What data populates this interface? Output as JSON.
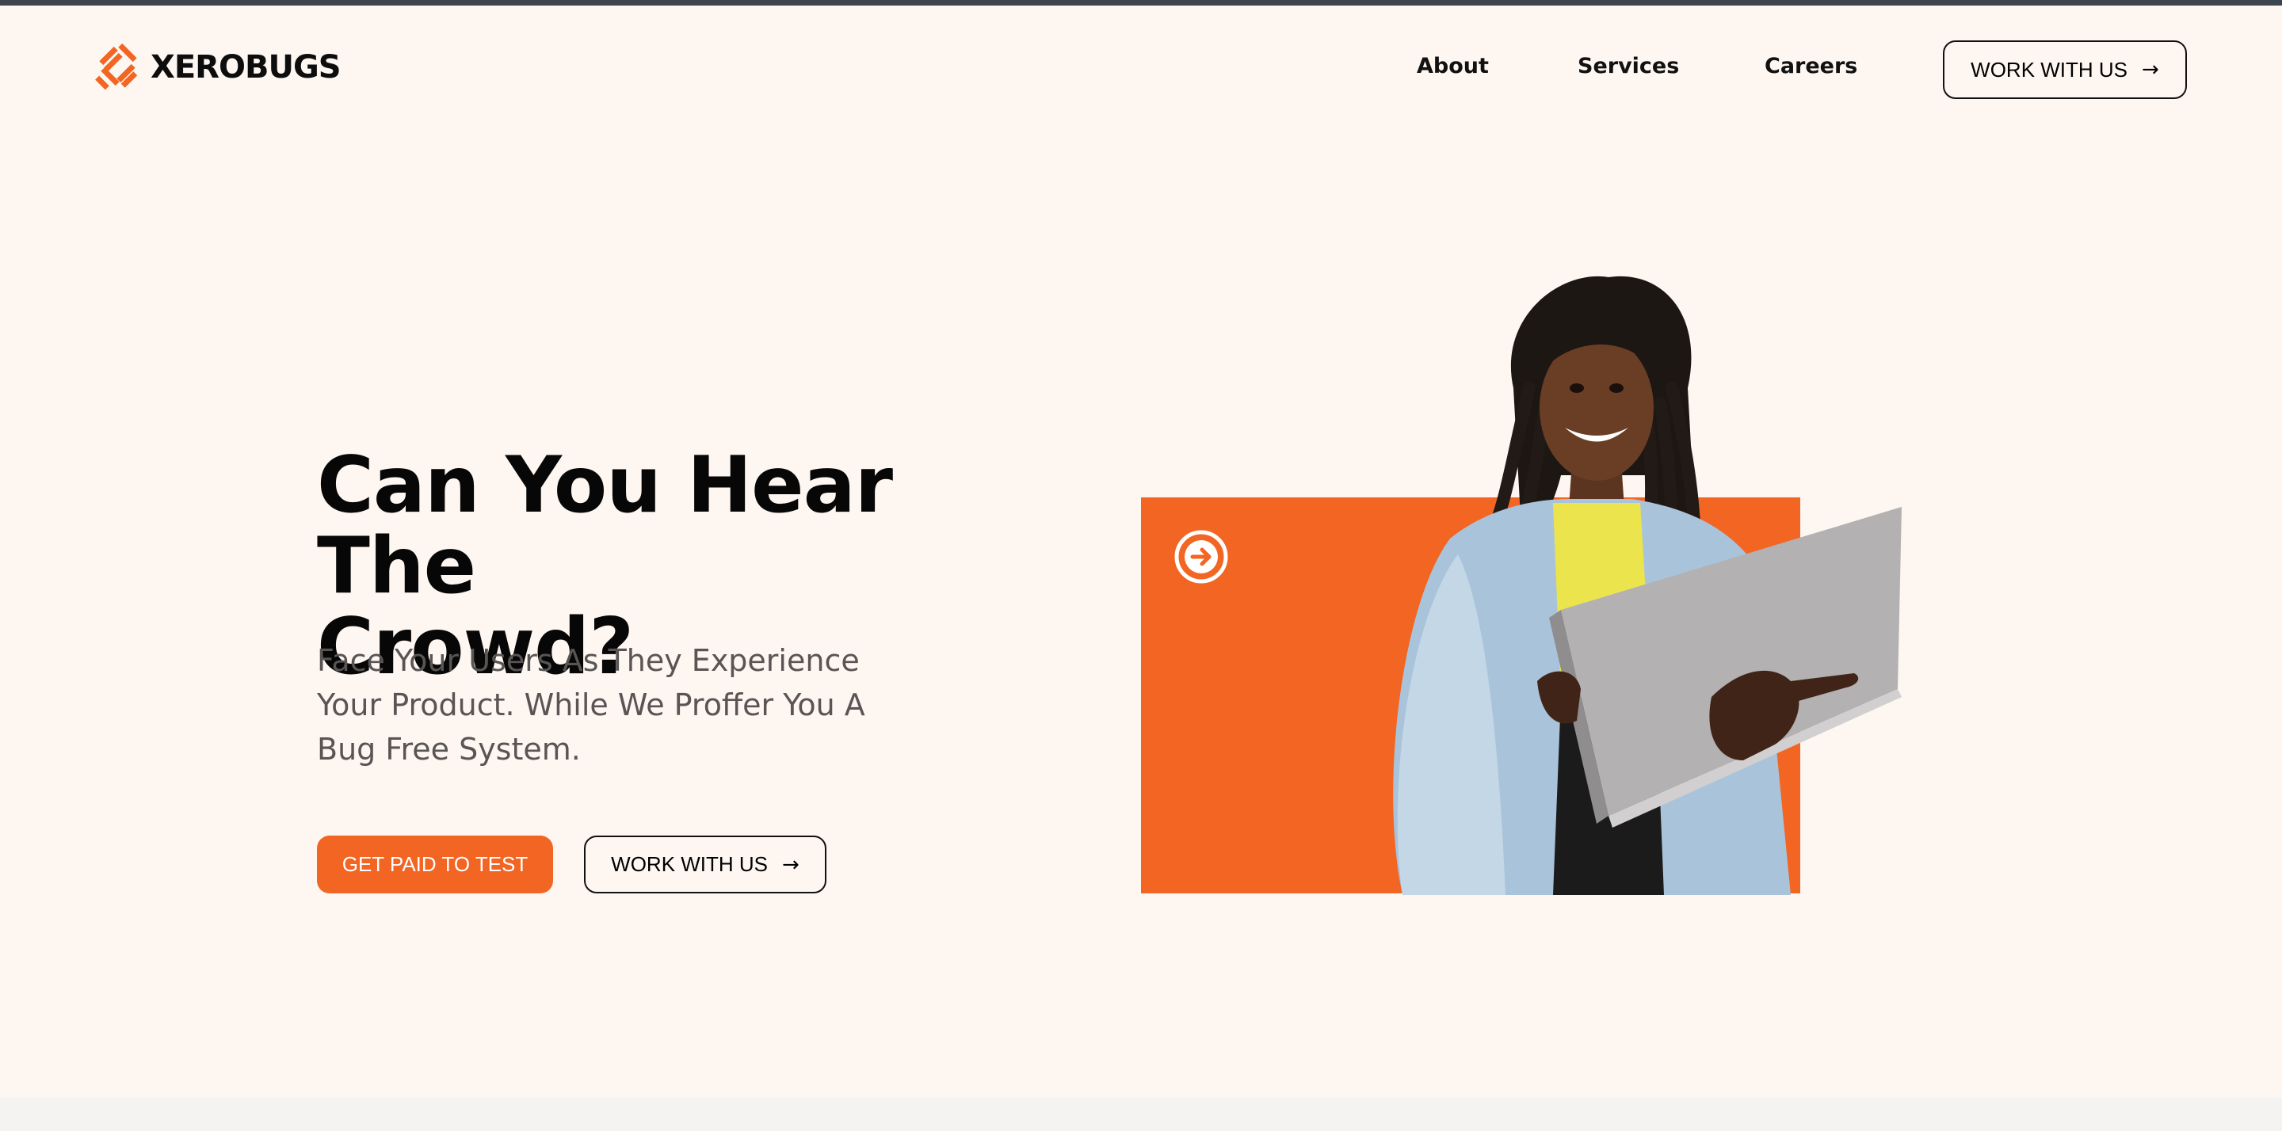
{
  "header": {
    "logo_text": "XEROBUGS",
    "nav": [
      "About",
      "Services",
      "Careers"
    ],
    "cta_label": "WORK WITH US"
  },
  "hero": {
    "title_line1": "Can You Hear The",
    "title_line2": "Crowd?",
    "subtitle": "Face Your Users As They Experience Your Product. While We Proffer You A Bug Free System.",
    "primary_label": "GET PAID TO TEST",
    "secondary_label": "WORK WITH US"
  },
  "icons": {
    "logo": "xerobugs-logo-icon",
    "arrow": "arrow-right-icon",
    "circle_arrow": "circle-arrow-right-icon"
  },
  "colors": {
    "accent": "#f26522",
    "background": "#fdf6f1",
    "text": "#070707",
    "muted": "#5a5555"
  }
}
